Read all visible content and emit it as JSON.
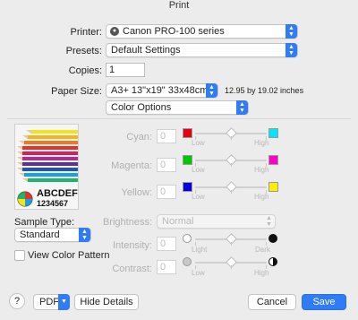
{
  "window": {
    "title": "Print"
  },
  "printer": {
    "label": "Printer:",
    "value": "Canon PRO-100 series"
  },
  "presets": {
    "label": "Presets:",
    "value": "Default Settings"
  },
  "copies": {
    "label": "Copies:",
    "value": "1"
  },
  "paper": {
    "label": "Paper Size:",
    "value": "A3+ 13\"x19\" 33x48cm",
    "dimensions": "12.95 by 19.02 inches"
  },
  "section": {
    "value": "Color Options"
  },
  "preview": {
    "text_line1": "ABCDEF",
    "text_line2": "1234567"
  },
  "cyan": {
    "label": "Cyan:",
    "value": "0",
    "low": "Low",
    "high": "High",
    "color_low": "#e60012",
    "color_high": "#00e5ff",
    "level": 0.5
  },
  "magenta": {
    "label": "Magenta:",
    "value": "0",
    "low": "Low",
    "high": "High",
    "color_low": "#00c800",
    "color_high": "#ff00c8",
    "level": 0.5
  },
  "yellow": {
    "label": "Yellow:",
    "value": "0",
    "low": "Low",
    "high": "High",
    "color_low": "#0000e0",
    "color_high": "#ffee00",
    "level": 0.5
  },
  "brightness": {
    "label": "Brightness:",
    "value": "Normal"
  },
  "intensity": {
    "label": "Intensity:",
    "value": "0",
    "low": "Light",
    "high": "Dark",
    "level": 0.5
  },
  "contrast": {
    "label": "Contrast:",
    "value": "0",
    "low": "Low",
    "high": "High",
    "level": 0.5
  },
  "sample": {
    "label": "Sample Type:",
    "value": "Standard"
  },
  "pattern": {
    "label": "View Color Pattern",
    "checked": false
  },
  "footer": {
    "help": "?",
    "pdf": "PDF",
    "hide_details": "Hide Details",
    "cancel": "Cancel",
    "save": "Save"
  }
}
